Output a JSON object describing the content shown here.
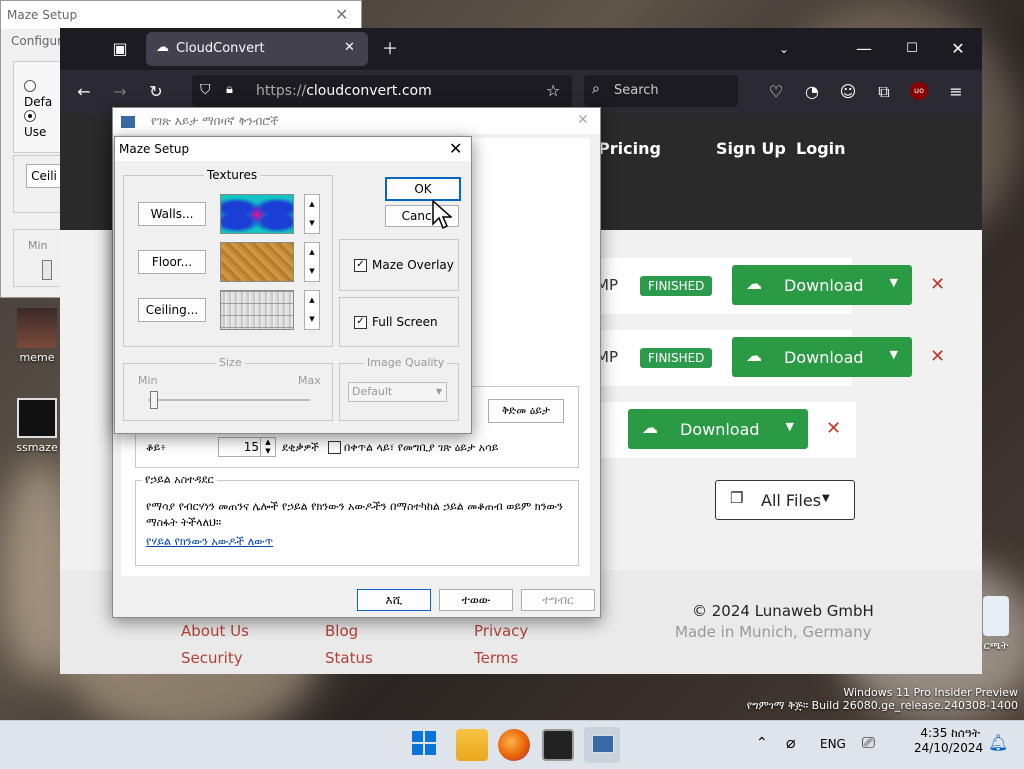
{
  "background_window": {
    "title": "Maze Setup",
    "group_label": "Configure",
    "radio_default": "Defa",
    "radio_user": "Use",
    "button": "Ceili",
    "slider_min": "Min"
  },
  "desktop_icons": [
    {
      "label": "meme"
    },
    {
      "label": "ssmaze"
    }
  ],
  "browser": {
    "tab_title": "CloudConvert",
    "url_prefix": "https://",
    "url_domain": "cloudconvert.com",
    "search_placeholder": "Search",
    "nav": {
      "pricing": "Pricing",
      "signup": "Sign Up",
      "login": "Login"
    },
    "rows": [
      {
        "format": "MP",
        "status": "FINISHED",
        "action": "Download"
      },
      {
        "format": "MP",
        "status": "FINISHED",
        "action": "Download"
      },
      {
        "action": "Download"
      }
    ],
    "all_files": "All Files",
    "footer": {
      "links_col1": [
        "About Us",
        "Security"
      ],
      "links_col2": [
        "Blog",
        "Status"
      ],
      "links_col3": [
        "Privacy",
        "Terms"
      ],
      "copyright": "© 2024 Lunaweb GmbH",
      "made_in": "Made in Munich, Germany"
    }
  },
  "screensaver_settings": {
    "title": "የገጽ እይታ ማበዛኛ ቅንብሮች",
    "preview_button": "ቅድመ ዕይታ",
    "wait_label": "ቆይ፥",
    "wait_value": "15",
    "minutes_label": "ደቂቃዎች",
    "resume_checkbox": "በቀጥል ላይ፣ የመግቢያ ገጽ ዕይታ አሳይ",
    "power_group": "የኃይል አስተዳደር",
    "power_text": "የማሳያ የብርሃነን መጠንና ሌሎች የኃይል የክንውን አውዶችን በማስተካከል ኃይል መቆጠብ ወይም ክንውን ማስፋት ትችላለህ።",
    "power_link": "የሃይል የክንውን አውዶች ለውጥ",
    "btn_ok": "እሺ",
    "btn_cancel": "ተወው",
    "btn_apply": "ተግብር"
  },
  "maze_setup": {
    "title": "Maze Setup",
    "textures_label": "Textures",
    "walls": "Walls...",
    "floor": "Floor...",
    "ceiling": "Ceiling...",
    "ok": "OK",
    "cancel": "Cancel",
    "maze_overlay": "Maze Overlay",
    "full_screen": "Full Screen",
    "size_label": "Size",
    "size_min": "Min",
    "size_max": "Max",
    "image_quality_label": "Image Quality",
    "image_quality_value": "Default"
  },
  "watermark": {
    "line1": "Windows 11 Pro Insider Preview",
    "line2": "የግምገማ ቅጅ። Build 26080.ge_release.240308-1400"
  },
  "taskbar": {
    "lang": "ENG",
    "time": "4:35 ከሰዓት",
    "date": "24/10/2024",
    "desktop_label_right": "ርጫት"
  }
}
